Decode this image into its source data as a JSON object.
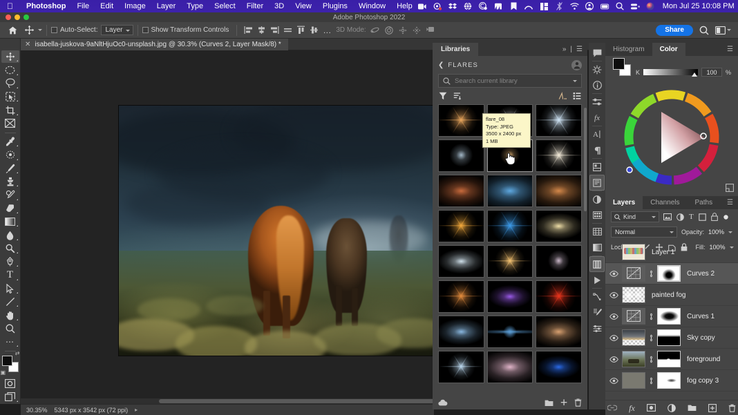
{
  "macbar": {
    "apple_icon": "apple-logo-icon",
    "menus": [
      "Photoshop",
      "File",
      "Edit",
      "Image",
      "Layer",
      "Type",
      "Select",
      "Filter",
      "3D",
      "View",
      "Plugins",
      "Window",
      "Help"
    ],
    "status_icons": [
      "screen-record-icon",
      "camera-icon",
      "dropbox-icon",
      "globe-icon",
      "creative-cloud-icon",
      "nordvpn-icon",
      "bookmark-icon",
      "arc-icon",
      "rectangle-split-icon",
      "bluetooth-off-icon",
      "wifi-icon",
      "user-account-icon",
      "battery-icon",
      "spotlight-search-icon",
      "control-center-icon",
      "siri-icon"
    ],
    "clock": "Mon Jul 25  10:08 PM"
  },
  "window": {
    "title": "Adobe Photoshop 2022"
  },
  "options_bar": {
    "home_icon": "home-icon",
    "tool_icon": "move-tool-icon",
    "auto_select_label": "Auto-Select:",
    "auto_select_value": "Layer",
    "show_transform_label": "Show Transform Controls",
    "align_icons": [
      "align-left-icon",
      "align-center-h-icon",
      "align-right-icon",
      "distribute-icon",
      "align-top-icon",
      "align-middle-v-icon"
    ],
    "more_icon": "more-options-icon",
    "mode_3d_label": "3D Mode:",
    "mode_3d_icons": [
      "orbit-3d-icon",
      "roll-3d-icon",
      "pan-3d-icon",
      "slide-3d-icon",
      "camera-3d-icon"
    ],
    "share_label": "Share",
    "search_icon": "search-icon",
    "workspace_icon": "workspace-switcher-icon"
  },
  "document_tab": {
    "close_icon": "close-tab-icon",
    "title": "isabella-juskova-9aNltHjuOc0-unsplash.jpg @ 30.3% (Curves 2, Layer Mask/8) *"
  },
  "toolbar": {
    "tools": [
      {
        "name": "move-tool",
        "icon": "move-icon",
        "selected": true,
        "has_more": true
      },
      {
        "name": "marquee-tool",
        "icon": "elliptical-marquee-icon",
        "selected": false,
        "has_more": true
      },
      {
        "name": "lasso-tool",
        "icon": "lasso-icon",
        "selected": false,
        "has_more": true
      },
      {
        "name": "object-selection-tool",
        "icon": "object-selection-icon",
        "selected": false,
        "has_more": true
      },
      {
        "name": "crop-tool",
        "icon": "crop-icon",
        "selected": false,
        "has_more": true
      },
      {
        "name": "frame-tool",
        "icon": "frame-icon",
        "selected": false,
        "has_more": false
      },
      {
        "name": "eyedropper-tool",
        "icon": "eyedropper-icon",
        "selected": false,
        "has_more": true
      },
      {
        "name": "spot-healing-tool",
        "icon": "spot-healing-brush-icon",
        "selected": false,
        "has_more": true
      },
      {
        "name": "brush-tool",
        "icon": "brush-icon",
        "selected": false,
        "has_more": true
      },
      {
        "name": "clone-stamp-tool",
        "icon": "clone-stamp-icon",
        "selected": false,
        "has_more": true
      },
      {
        "name": "history-brush-tool",
        "icon": "history-brush-icon",
        "selected": false,
        "has_more": true
      },
      {
        "name": "eraser-tool",
        "icon": "eraser-icon",
        "selected": false,
        "has_more": true
      },
      {
        "name": "gradient-tool",
        "icon": "gradient-icon",
        "selected": false,
        "has_more": true
      },
      {
        "name": "blur-tool",
        "icon": "blur-icon",
        "selected": false,
        "has_more": true
      },
      {
        "name": "dodge-tool",
        "icon": "dodge-icon",
        "selected": false,
        "has_more": true
      },
      {
        "name": "pen-tool",
        "icon": "pen-icon",
        "selected": false,
        "has_more": true
      },
      {
        "name": "type-tool",
        "icon": "type-icon",
        "selected": false,
        "has_more": true
      },
      {
        "name": "path-selection-tool",
        "icon": "path-selection-arrow-icon",
        "selected": false,
        "has_more": true
      },
      {
        "name": "line-tool",
        "icon": "line-shape-icon",
        "selected": false,
        "has_more": true
      },
      {
        "name": "hand-tool",
        "icon": "hand-icon",
        "selected": false,
        "has_more": true
      },
      {
        "name": "zoom-tool",
        "icon": "zoom-magnifier-icon",
        "selected": false,
        "has_more": false
      },
      {
        "name": "edit-toolbar",
        "icon": "ellipsis-icon",
        "selected": false,
        "has_more": true
      }
    ],
    "swap_icon": "swap-colors-icon",
    "default_icon": "default-colors-icon",
    "foreground_color": "#0d0d0d",
    "background_color": "#ffffff",
    "quick_mask_icon": "quick-mask-icon",
    "screen_mode_icon": "screen-mode-icon"
  },
  "status_bar": {
    "zoom": "30.35%",
    "doc_size": "5343 px x 3542 px (72 ppi)",
    "arrow_icon": "chevron-right-icon"
  },
  "libraries": {
    "tab_label": "Libraries",
    "collapse_icon": "double-chevron-right-icon",
    "panel_menu_icon": "panel-menu-icon",
    "back_icon": "chevron-left-icon",
    "library_name": "FLARES",
    "avatar_icon": "user-avatar-icon",
    "search_placeholder": "Search current library",
    "search_value": "",
    "search_icon": "search-icon",
    "search_caret_icon": "chevron-down-icon",
    "filter_icon": "filter-icon",
    "sort_icon": "sort-icon",
    "refine_icon": "refine-icon",
    "view_list_icon": "list-view-icon",
    "cloud_icon": "cloud-sync-icon",
    "new_folder_icon": "new-folder-icon",
    "add_icon": "add-element-icon",
    "delete_icon": "delete-icon",
    "hovered_item_label": "flare_08",
    "tooltip": {
      "name": "flare_08",
      "type": "Type: JPEG",
      "dimensions": "3500 x 2400 px",
      "size": "1 MB"
    },
    "items": [
      {
        "id": "flare_01",
        "color": "#e8a55c",
        "style": "star",
        "size": 30
      },
      {
        "id": "flare_02",
        "color": "#ffffff",
        "style": "star",
        "size": 26
      },
      {
        "id": "flare_03",
        "color": "#cfe4f5",
        "style": "star",
        "size": 34
      },
      {
        "id": "flare_07",
        "color": "#bcd4e6",
        "style": "soft",
        "size": 24
      },
      {
        "id": "flare_08",
        "color": "#e8b878",
        "style": "soft",
        "size": 20
      },
      {
        "id": "flare_09",
        "color": "#f2ead8",
        "style": "star",
        "size": 30
      },
      {
        "id": "flare_10",
        "color": "#c86a3c",
        "style": "glow",
        "size": 40
      },
      {
        "id": "flare_11",
        "color": "#5ea8e0",
        "style": "glow",
        "size": 46
      },
      {
        "id": "flare_12",
        "color": "#d4884a",
        "style": "glow",
        "size": 44
      },
      {
        "id": "flare_13",
        "color": "#f0a83c",
        "style": "star",
        "size": 30
      },
      {
        "id": "flare_14",
        "color": "#3d9ae8",
        "style": "star",
        "size": 34
      },
      {
        "id": "flare_15",
        "color": "#f0dfa8",
        "style": "glow",
        "size": 30
      },
      {
        "id": "flare_16",
        "color": "#cfe0ea",
        "style": "glow",
        "size": 28
      },
      {
        "id": "flare_17",
        "color": "#f2c070",
        "style": "star",
        "size": 28
      },
      {
        "id": "flare_18",
        "color": "#ead4e8",
        "style": "soft",
        "size": 22
      },
      {
        "id": "flare_19",
        "color": "#e08a3c",
        "style": "star",
        "size": 30
      },
      {
        "id": "flare_20",
        "color": "#9a5ae8",
        "style": "glow",
        "size": 26
      },
      {
        "id": "flare_21",
        "color": "#e8341c",
        "style": "star",
        "size": 32
      },
      {
        "id": "flare_22",
        "color": "#8ab8e0",
        "style": "glow",
        "size": 30
      },
      {
        "id": "flare_23",
        "color": "#5a9cd4",
        "style": "streak",
        "size": 20
      },
      {
        "id": "flare_24",
        "color": "#d8a070",
        "style": "glow",
        "size": 36
      },
      {
        "id": "flare_25",
        "color": "#b8d4ea",
        "style": "star",
        "size": 26
      },
      {
        "id": "flare_26",
        "color": "#e0b4c8",
        "style": "glow",
        "size": 40
      },
      {
        "id": "flare_27",
        "color": "#2a6ae8",
        "style": "glow",
        "size": 26
      }
    ]
  },
  "rail": {
    "icons": [
      {
        "name": "comment-panel-icon",
        "selected": false
      },
      {
        "name": "adjustments-panel-icon",
        "selected": false
      },
      {
        "name": "info-panel-icon",
        "selected": false
      },
      {
        "name": "properties-panel-icon",
        "selected": false
      },
      {
        "name": "layer-styles-panel-icon",
        "selected": false
      },
      {
        "name": "character-panel-icon",
        "selected": false
      },
      {
        "name": "paragraph-panel-icon",
        "selected": false
      },
      {
        "name": "libraries-panel-icon",
        "selected": false
      },
      {
        "name": "notes-panel-icon",
        "selected": true
      },
      {
        "name": "color-panel-icon",
        "selected": false
      },
      {
        "name": "swatches-panel-icon",
        "selected": false
      },
      {
        "name": "patterns-panel-icon",
        "selected": false
      },
      {
        "name": "gradients-panel-icon",
        "selected": false
      },
      {
        "name": "layers-panel-icon",
        "selected": true
      },
      {
        "name": "timeline-panel-icon",
        "selected": false
      },
      {
        "name": "paths-panel-icon",
        "selected": false
      },
      {
        "name": "brushes-panel-icon",
        "selected": false
      },
      {
        "name": "brush-settings-panel-icon",
        "selected": false
      }
    ]
  },
  "color_panel": {
    "tabs": [
      {
        "label": "Histogram",
        "active": false
      },
      {
        "label": "Color",
        "active": true
      }
    ],
    "menu_icon": "panel-menu-icon",
    "foreground_color": "#0d0d0d",
    "background_color": "#ffffff",
    "channel_label": "K",
    "channel_value": "100",
    "channel_unit": "%",
    "expand_icon": "expand-icon"
  },
  "layers_panel": {
    "tabs": [
      {
        "label": "Layers",
        "active": true
      },
      {
        "label": "Channels",
        "active": false
      },
      {
        "label": "Paths",
        "active": false
      }
    ],
    "menu_icon": "panel-menu-icon",
    "filter_label": "Kind",
    "filter_search_icon": "search-icon",
    "filter_type_icons": [
      "filter-pixel-icon",
      "filter-adjustment-icon",
      "filter-type-icon",
      "filter-shape-icon",
      "filter-smart-icon"
    ],
    "toggle_filter_icon": "toggle-filter-icon",
    "blend_mode": "Normal",
    "opacity_label": "Opacity:",
    "opacity_value": "100%",
    "lock_label": "Lock:",
    "lock_icons": [
      "lock-transparent-icon",
      "lock-image-icon",
      "lock-position-icon",
      "lock-artboard-icon",
      "lock-all-icon"
    ],
    "fill_label": "Fill:",
    "fill_value": "100%",
    "layers": [
      {
        "name": "Layer 1",
        "visible": false,
        "selected": false,
        "kind": "pixel",
        "has_mask": false,
        "linked": false
      },
      {
        "name": "Curves 2",
        "visible": true,
        "selected": true,
        "kind": "adjustment",
        "has_mask": true,
        "linked": true
      },
      {
        "name": "painted fog",
        "visible": true,
        "selected": false,
        "kind": "pixel",
        "has_mask": false,
        "linked": false
      },
      {
        "name": "Curves 1",
        "visible": true,
        "selected": false,
        "kind": "adjustment",
        "has_mask": true,
        "linked": true
      },
      {
        "name": "Sky copy",
        "visible": true,
        "selected": false,
        "kind": "pixel",
        "has_mask": true,
        "linked": true
      },
      {
        "name": "foreground",
        "visible": true,
        "selected": false,
        "kind": "pixel",
        "has_mask": true,
        "linked": true
      },
      {
        "name": "fog copy 3",
        "visible": true,
        "selected": false,
        "kind": "pixel",
        "has_mask": true,
        "linked": true
      }
    ],
    "bottom_icons": [
      "link-layers-icon",
      "layer-styles-fx-icon",
      "add-layer-mask-icon",
      "new-adjustment-layer-icon",
      "new-group-icon",
      "new-layer-icon",
      "delete-layer-icon"
    ]
  },
  "canvas": {
    "document_name": "isabella-juskova-9aNltHjuOc0-unsplash.jpg"
  }
}
